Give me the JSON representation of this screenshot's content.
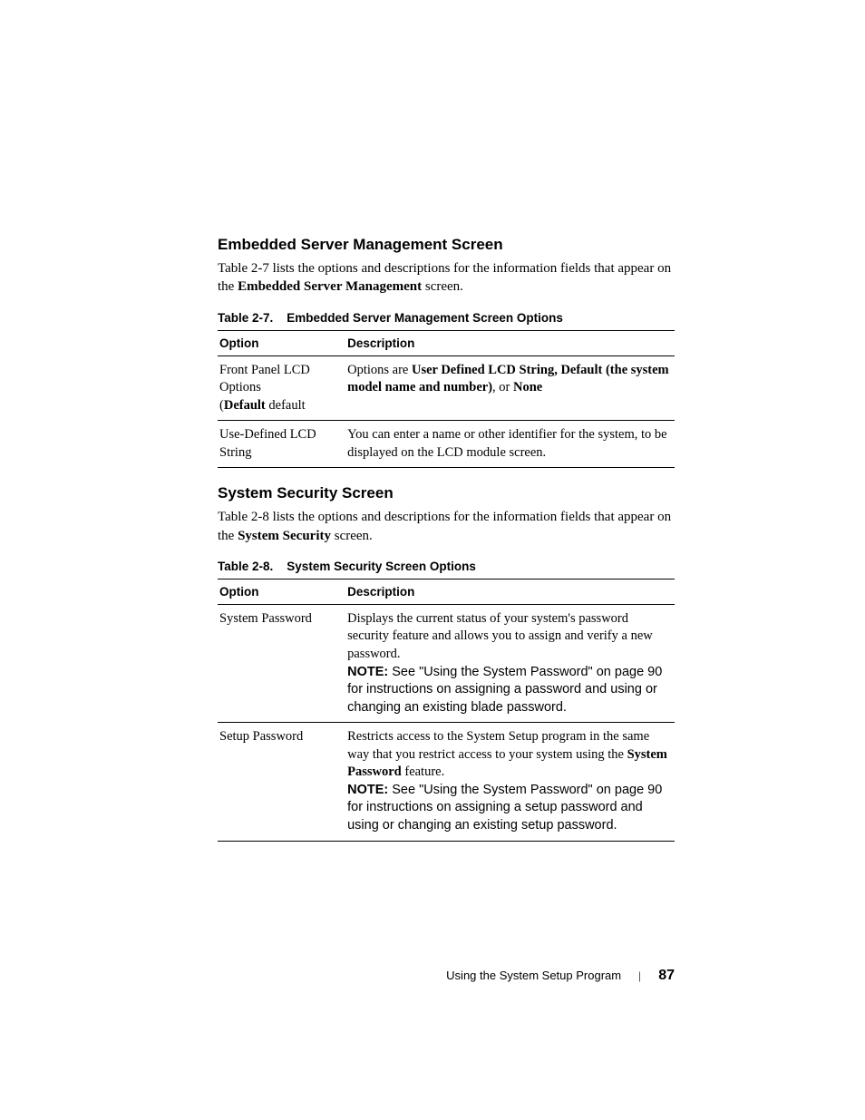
{
  "section1": {
    "heading": "Embedded Server Management Screen",
    "intro_a": "Table 2-7 lists the options and descriptions for the information fields that appear on the ",
    "intro_b_bold": "Embedded Server Management",
    "intro_c": " screen."
  },
  "table1": {
    "caption_label": "Table 2-7.",
    "caption_title": "Embedded Server Management Screen Options",
    "headers": {
      "option": "Option",
      "description": "Description"
    },
    "rows": [
      {
        "option_line1": "Front Panel LCD Options",
        "option_line2_a": "(",
        "option_line2_b_bold": "Default",
        "option_line2_c": " default",
        "desc_a": "Options are ",
        "desc_b_bold": "User Defined LCD String, Default (the system model name and number)",
        "desc_c": ", or ",
        "desc_d_bold": "None"
      },
      {
        "option_line1": "Use-Defined LCD String",
        "desc_text": "You can enter a name or other identifier for the system, to be displayed on the LCD module screen."
      }
    ]
  },
  "section2": {
    "heading": "System Security Screen",
    "intro_a": "Table 2-8 lists the options and descriptions for the information fields that appear on the ",
    "intro_b_bold": "System Security",
    "intro_c": " screen."
  },
  "table2": {
    "caption_label": "Table 2-8.",
    "caption_title": "System Security Screen Options",
    "headers": {
      "option": "Option",
      "description": "Description"
    },
    "rows": [
      {
        "option": "System Password",
        "desc_text": "Displays the current status of your system's password security feature and allows you to assign and verify a new password.",
        "note_label": "NOTE: ",
        "note_text": "See \"Using the System Password\" on page 90 for instructions on assigning a password and using or changing an existing blade password."
      },
      {
        "option": "Setup Password",
        "desc_a": "Restricts access to the System Setup program in the same way that you restrict access to your system using the ",
        "desc_b_bold": "System Password",
        "desc_c": " feature.",
        "note_label": "NOTE: ",
        "note_text": "See \"Using the System Password\" on page 90 for instructions on assigning a setup password and using or changing an existing setup password."
      }
    ]
  },
  "footer": {
    "chapter": "Using the System Setup Program",
    "separator": "|",
    "page": "87"
  }
}
